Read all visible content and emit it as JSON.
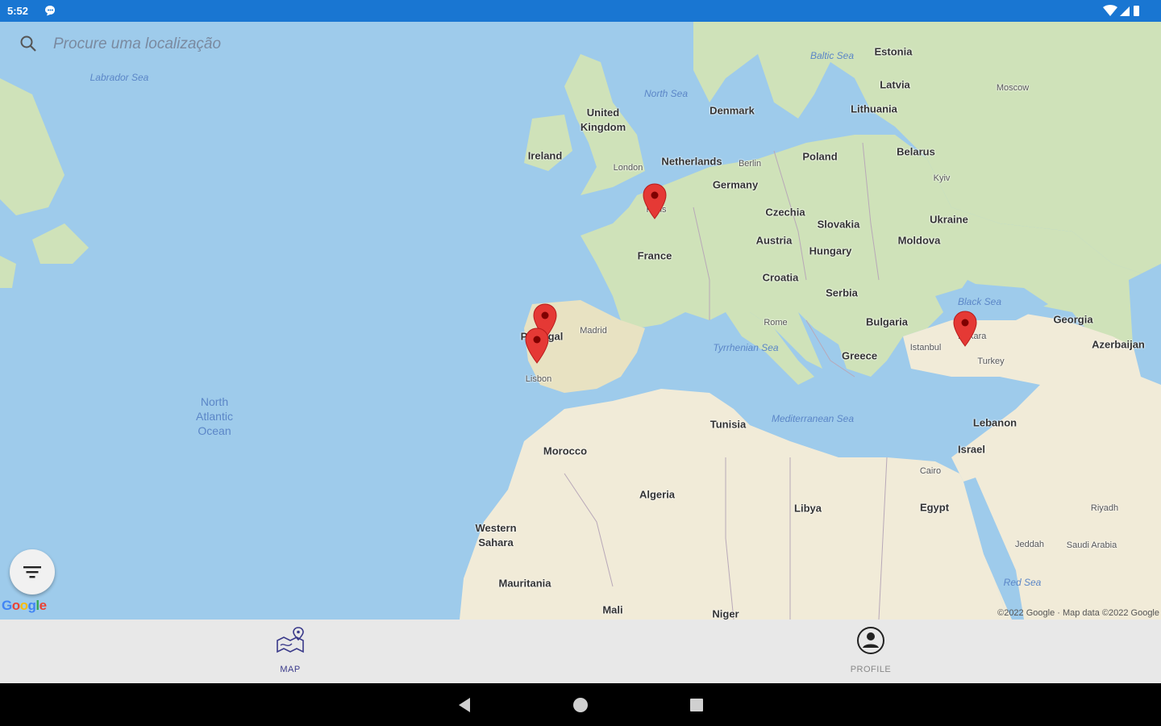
{
  "status_bar": {
    "time": "5:52",
    "icons": [
      "chat-icon",
      "wifi-icon",
      "signal-icon",
      "battery-icon"
    ]
  },
  "search": {
    "placeholder": "Procure uma localização",
    "value": "",
    "icon": "search-icon"
  },
  "map_labels": {
    "seas": {
      "labrador": "Labrador Sea",
      "baltic": "Baltic Sea",
      "north": "North Sea",
      "black": "Black Sea",
      "tyrrhenian": "Tyrrhenian Sea",
      "mediterranean": "Mediterranean Sea",
      "red": "Red Sea"
    },
    "ocean": "North Atlantic Ocean",
    "countries": {
      "estonia": "Estonia",
      "latvia": "Latvia",
      "lithuania": "Lithuania",
      "denmark": "Denmark",
      "uk": "United Kingdom",
      "ireland": "Ireland",
      "netherlands": "Netherlands",
      "germany": "Germany",
      "poland": "Poland",
      "belarus": "Belarus",
      "ukraine": "Ukraine",
      "czechia": "Czechia",
      "slovakia": "Slovakia",
      "austria": "Austria",
      "hungary": "Hungary",
      "moldova": "Moldova",
      "france": "France",
      "croatia": "Croatia",
      "serbia": "Serbia",
      "bulgaria": "Bulgaria",
      "georgia": "Georgia",
      "azerbaijan": "Azerbaijan",
      "portugal": "Portugal",
      "greece": "Greece",
      "tunisia": "Tunisia",
      "lebanon": "Lebanon",
      "israel": "Israel",
      "morocco": "Morocco",
      "algeria": "Algeria",
      "libya": "Libya",
      "egypt": "Egypt",
      "western_sahara": "Western Sahara",
      "mauritania": "Mauritania",
      "mali": "Mali",
      "niger": "Niger"
    },
    "cities": {
      "moscow": "Moscow",
      "london": "London",
      "berlin": "Berlin",
      "kyiv": "Kyiv",
      "paris": "Paris",
      "madrid": "Madrid",
      "rome": "Rome",
      "lisbon": "Lisbon",
      "istanbul": "Istanbul",
      "ankara": "Ankara",
      "turkey": "Turkey",
      "cairo": "Cairo",
      "riyadh": "Riyadh",
      "jeddah": "Jeddah",
      "saudi": "Saudi Arabia"
    }
  },
  "markers": [
    {
      "name": "paris-marker",
      "place": "Paris"
    },
    {
      "name": "porto-marker",
      "place": "Porto"
    },
    {
      "name": "lisbon-area-marker",
      "place": "Lisbon"
    },
    {
      "name": "ankara-marker",
      "place": "Ankara"
    }
  ],
  "map_footer": {
    "logo": "Google",
    "attribution": "©2022 Google · Map data ©2022 Google"
  },
  "bottom_nav": {
    "map_label": "MAP",
    "profile_label": "PROFILE",
    "active": "MAP"
  },
  "colors": {
    "status_bar": "#1976d2",
    "water": "#9ecbeb",
    "land_north": "#cfe2b9",
    "land_south": "#f1ebd8",
    "marker": "#e53935",
    "nav_bg": "#e8e8e8"
  }
}
